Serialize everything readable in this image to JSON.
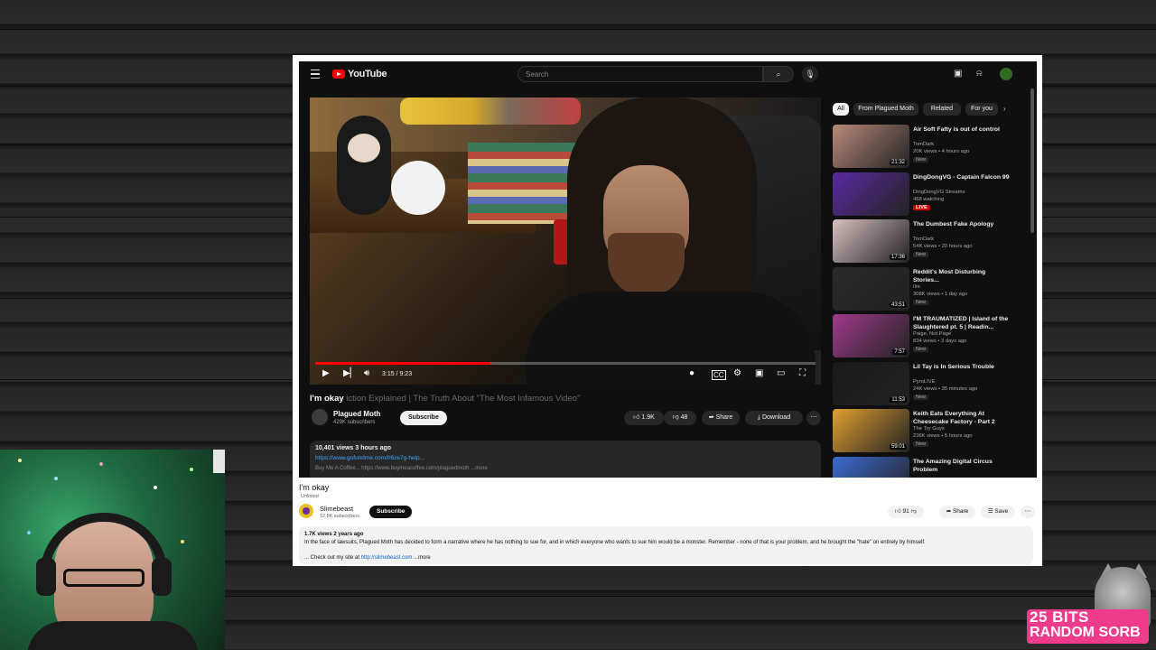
{
  "youtube_dark": {
    "logo_text": "YouTube",
    "search_placeholder": "Search",
    "chips": [
      "All",
      "From Plagued Moth",
      "Related",
      "For you"
    ],
    "player": {
      "time": "3:15 / 9:23",
      "progress": 0.35
    },
    "video_title": "I'm okay",
    "video_title_faded": "iction Explained | The Truth About \"The Most Infamous Video\"",
    "channel_name": "Plagued Moth",
    "channel_subs": "429K subscribers",
    "subscribe_label": "Subscribe",
    "likes": "1.9K",
    "dislikes": "48",
    "share_label": "Share",
    "download_label": "Download",
    "desc_views": "10,401 views  3 hours ago",
    "desc_link": "https://www.gofundme.com/f/6ze7g-help...",
    "desc_more": "Buy Me A Coffee...  https://www.buymeacoffee.com/plaguedmoth   ...more",
    "related": [
      {
        "title": "Air Soft Fatty is out of control",
        "channel": "TomDark",
        "meta": "20K views • 4 hours ago",
        "badge": "New",
        "duration": "21:32",
        "thumb": "#b88a7a"
      },
      {
        "title": "DingDongVG - Captain Falcon 99",
        "channel": "DingDongVG Streams",
        "meta": "468 watching",
        "badge": "LIVE",
        "duration": "",
        "thumb": "#5a2aa0"
      },
      {
        "title": "The Dumbest Fake Apology",
        "channel": "TomDark",
        "meta": "54K views • 20 hours ago",
        "badge": "New",
        "duration": "17:36",
        "thumb": "#d8c0c0"
      },
      {
        "title": "Reddit's Most Disturbing Stories...",
        "channel": "Ilm",
        "meta": "308K views • 1 day ago",
        "badge": "New",
        "duration": "43:51",
        "thumb": "#2a2a2a"
      },
      {
        "title": "I'M TRAUMATIZED | Island of the Slaughtered pt. 5 | Readin...",
        "channel": "Paige, Not Page",
        "meta": "834 views • 3 days ago",
        "badge": "New",
        "duration": "7:57",
        "thumb": "#a03a8a"
      },
      {
        "title": "Lil Tay is In Serious Trouble",
        "channel": "PyroLIVE",
        "meta": "24K views • 35 minutes ago",
        "badge": "New",
        "duration": "11:53",
        "thumb": "#1a1a1a"
      },
      {
        "title": "Keith Eats Everything At Cheesecake Factory - Part 2",
        "channel": "The Try Guys",
        "meta": "236K views • 5 hours ago",
        "badge": "New",
        "duration": "59:01",
        "thumb": "#e0a030"
      },
      {
        "title": "The Amazing Digital Circus Problem",
        "channel": "",
        "meta": "",
        "badge": "",
        "duration": "",
        "thumb": "#3a6ad0"
      }
    ]
  },
  "youtube_light": {
    "title": "I'm okay",
    "unlisted": "Unlisted",
    "channel_name": "Slimebeast",
    "channel_subs": "12.8K subscribers",
    "subscribe_label": "Subscribe",
    "likes": "91",
    "share_label": "Share",
    "save_label": "Save",
    "desc_views": "1.7K views  2 years ago",
    "desc_text": "In the face of lawsuits, Plagued Moth has decided to form a narrative where he has nothing to sue for, and in which everyone who wants to sue him would be a monster. Remember - none of that is your problem, and he brought the \"hate\" on entirely by himself.",
    "desc_line3_prefix": "... Check out my site at ",
    "desc_link": "http://slimebeast.com",
    "desc_more": "...more"
  },
  "badge": {
    "line1": "25 BITS",
    "line2": "RANDOM SORB"
  },
  "colors": {
    "yt_red": "#ff0000",
    "badge_pink": "#ef3b8c",
    "link_blue": "#3ea6ff"
  }
}
